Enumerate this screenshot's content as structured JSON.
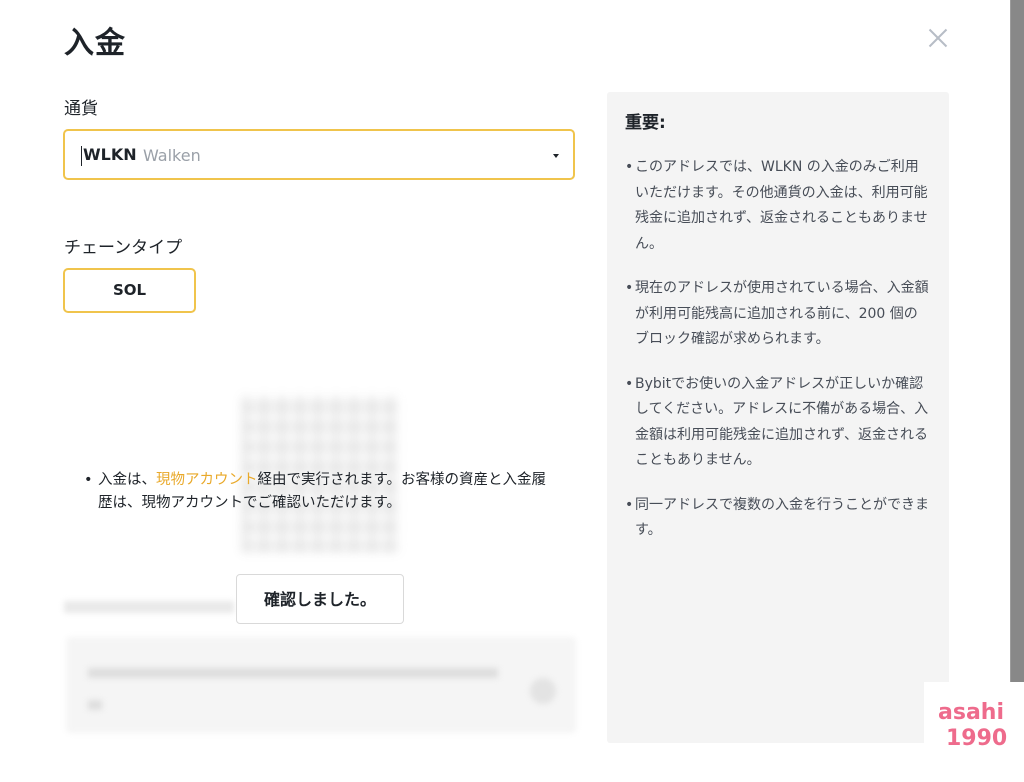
{
  "modal": {
    "title": "入金",
    "currency_label": "通貨",
    "currency": {
      "code": "WLKN",
      "name": "Walken"
    },
    "chain_label": "チェーンタイプ",
    "chain_option": "SOL"
  },
  "notice": {
    "bullet": "•",
    "before": "入金は、",
    "highlight": "現物アカウント",
    "after": "経由で実行されます。お客様の資産と入金履歴は、現物アカウントでご確認いただけます。",
    "confirm_button": "確認しました。"
  },
  "info": {
    "title": "重要:",
    "items": [
      "このアドレスでは、WLKN の入金のみご利用いただけます。その他通貨の入金は、利用可能残金に追加されず、返金されることもありません。",
      "現在のアドレスが使用されている場合、入金額が利用可能残高に追加される前に、200 個のブロック確認が求められます。",
      "Bybitでお使いの入金アドレスが正しいか確認してください。アドレスに不備がある場合、入金額は利用可能残金に追加されず、返金されることもありません。",
      "同一アドレスで複数の入金を行うことができます。"
    ]
  },
  "watermark": {
    "line1": "asahi",
    "line2": "1990"
  },
  "colors": {
    "accent": "#f0c44c",
    "highlight": "#e9a92a",
    "panel": "#f4f4f4",
    "watermark": "#ee6b8c"
  },
  "icons": {
    "close": "close-icon",
    "dropdown": "chevron-down-icon"
  }
}
